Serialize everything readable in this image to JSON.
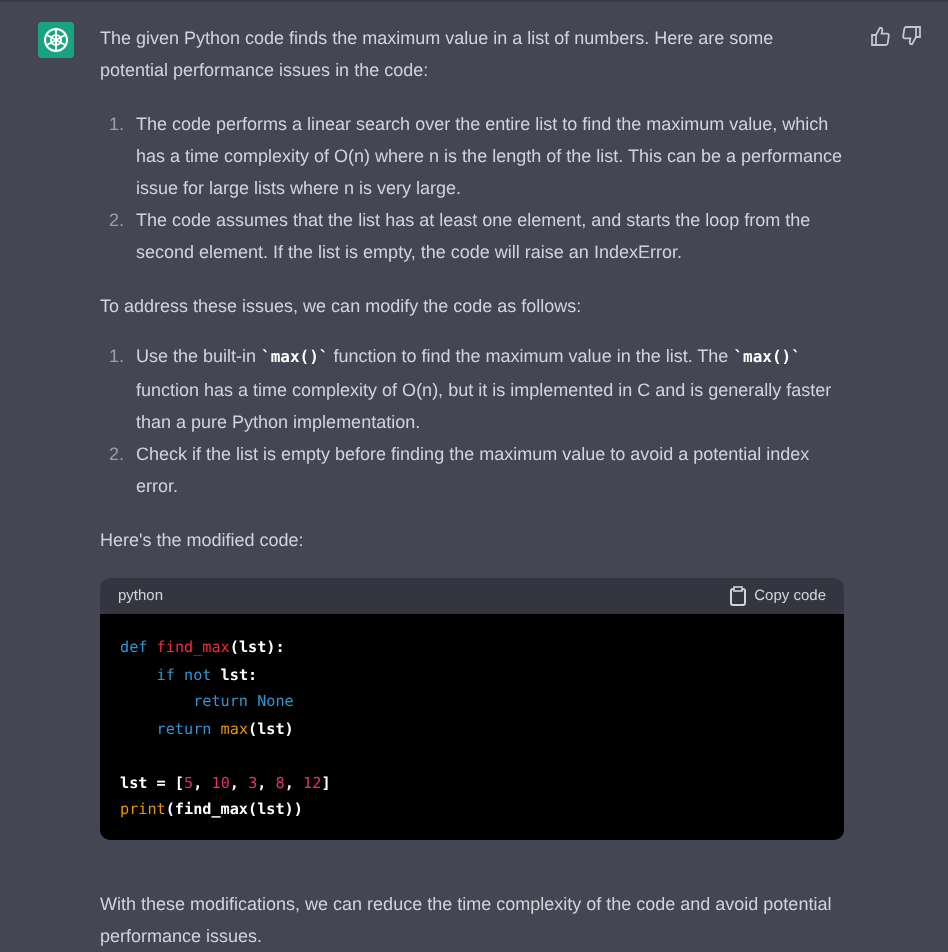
{
  "message": {
    "intro": "The given Python code finds the maximum value in a list of numbers. Here are some potential performance issues in the code:",
    "issues": [
      {
        "number": "1.",
        "segments": [
          {
            "kind": "text",
            "text": "The code performs a linear search over the entire list to find the maximum value, which has a time complexity of O(n) where n is the length of the list. This can be a performance issue for large lists where n is very large."
          }
        ]
      },
      {
        "number": "2.",
        "segments": [
          {
            "kind": "text",
            "text": "The code assumes that the list has at least one element, and starts the loop from the second element. If the list is empty, the code will raise an IndexError."
          }
        ]
      }
    ],
    "transition": "To address these issues, we can modify the code as follows:",
    "fixes": [
      {
        "number": "1.",
        "segments": [
          {
            "kind": "text",
            "text": "Use the built-in "
          },
          {
            "kind": "code",
            "text": "`max()`"
          },
          {
            "kind": "text",
            "text": " function to find the maximum value in the list. The "
          },
          {
            "kind": "code",
            "text": "`max()`"
          },
          {
            "kind": "text",
            "text": " function has a time complexity of O(n), but it is implemented in C and is generally faster than a pure Python implementation."
          }
        ]
      },
      {
        "number": "2.",
        "segments": [
          {
            "kind": "text",
            "text": "Check if the list is empty before finding the maximum value to avoid a potential index error."
          }
        ]
      }
    ],
    "code_intro": "Here's the modified code:",
    "code_block": {
      "language": "python",
      "copy_label": "Copy code",
      "lines": [
        {
          "kind": "code",
          "tokens": [
            {
              "kind": "keyword",
              "text": "def "
            },
            {
              "kind": "function",
              "text": "find_max"
            },
            {
              "kind": "plain",
              "text": "(lst):"
            }
          ]
        },
        {
          "kind": "code",
          "tokens": [
            {
              "kind": "keyword",
              "text": "    if not "
            },
            {
              "kind": "plain",
              "text": "lst:"
            }
          ]
        },
        {
          "kind": "code",
          "tokens": [
            {
              "kind": "keyword",
              "text": "        return None"
            }
          ]
        },
        {
          "kind": "code",
          "tokens": [
            {
              "kind": "keyword",
              "text": "    return "
            },
            {
              "kind": "builtin",
              "text": "max"
            },
            {
              "kind": "plain",
              "text": "(lst)"
            }
          ]
        },
        {
          "kind": "blank"
        },
        {
          "kind": "code",
          "tokens": [
            {
              "kind": "plain",
              "text": "lst = ["
            },
            {
              "kind": "number",
              "text": "5"
            },
            {
              "kind": "plain",
              "text": ", "
            },
            {
              "kind": "number",
              "text": "10"
            },
            {
              "kind": "plain",
              "text": ", "
            },
            {
              "kind": "number",
              "text": "3"
            },
            {
              "kind": "plain",
              "text": ", "
            },
            {
              "kind": "number",
              "text": "8"
            },
            {
              "kind": "plain",
              "text": ", "
            },
            {
              "kind": "number",
              "text": "12"
            },
            {
              "kind": "plain",
              "text": "]"
            }
          ]
        },
        {
          "kind": "code",
          "tokens": [
            {
              "kind": "builtin",
              "text": "print"
            },
            {
              "kind": "plain",
              "text": "(find_max(lst))"
            }
          ]
        }
      ]
    },
    "conclusion": "With these modifications, we can reduce the time complexity of the code and avoid potential performance issues."
  }
}
